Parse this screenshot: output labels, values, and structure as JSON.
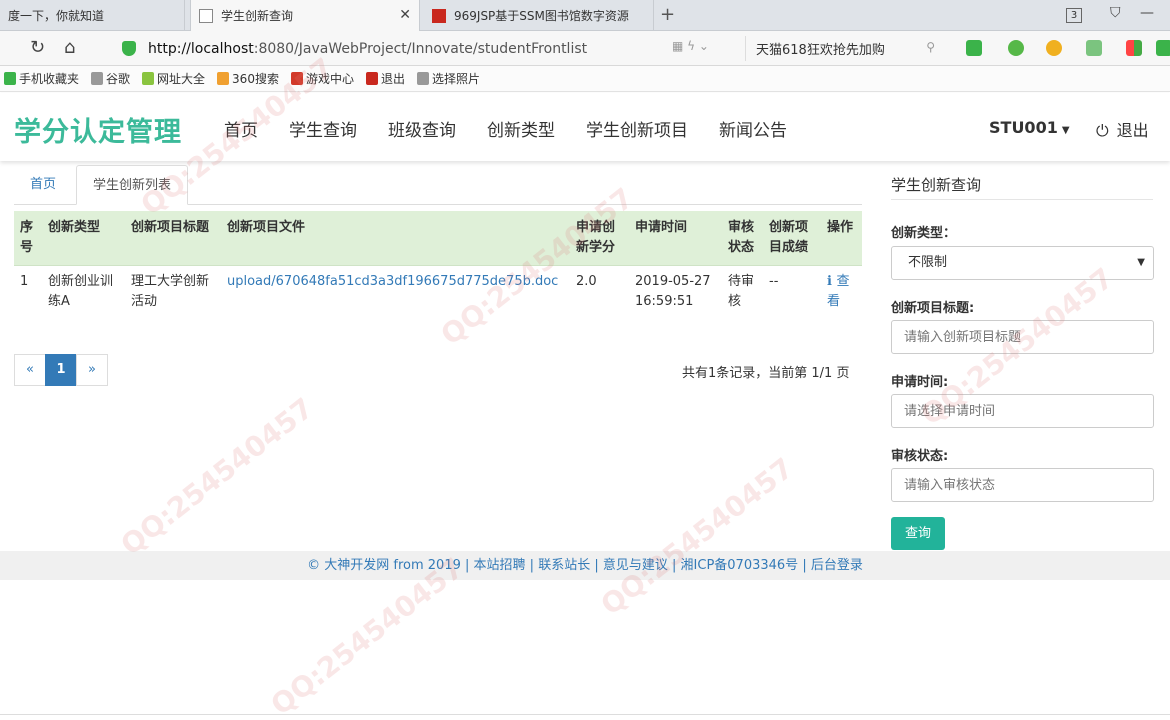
{
  "browser": {
    "tabs": [
      {
        "title": "度一下，你就知道"
      },
      {
        "title": "学生创新查询"
      },
      {
        "title": "969JSP基于SSM图书馆数字资源"
      }
    ],
    "window_count": "3",
    "url_host": "http://localhost",
    "url_rest": ":8080/JavaWebProject/Innovate/studentFrontlist",
    "search_text": "天猫618狂欢抢先加购"
  },
  "bookmarks": [
    {
      "label": "手机收藏夹",
      "color": "#3bb34a"
    },
    {
      "label": "谷歌",
      "color": "#999999"
    },
    {
      "label": "网址大全",
      "color": "#8ac43f"
    },
    {
      "label": "360搜索",
      "color": "#f0a030"
    },
    {
      "label": "游戏中心",
      "color": "#d23a2a"
    },
    {
      "label": "退出",
      "color": "#c9281e"
    },
    {
      "label": "选择照片",
      "color": "#999999"
    }
  ],
  "nav": {
    "brand": "学分认定管理",
    "links": [
      "首页",
      "学生查询",
      "班级查询",
      "创新类型",
      "学生创新项目",
      "新闻公告"
    ],
    "user": "STU001",
    "logout": "退出"
  },
  "page_tabs": {
    "home": "首页",
    "active": "学生创新列表"
  },
  "table": {
    "headers": [
      "序号",
      "创新类型",
      "创新项目标题",
      "创新项目文件",
      "申请创新学分",
      "申请时间",
      "审核状态",
      "创新项目成绩",
      "操作"
    ],
    "rows": [
      {
        "no": "1",
        "type": "创新创业训练A",
        "title": "理工大学创新活动",
        "file": "upload/670648fa51cd3a3df196675d775de75b.doc",
        "credit": "2.0",
        "time": "2019-05-27 16:59:51",
        "status": "待审核",
        "score": "--",
        "action": "查看"
      }
    ]
  },
  "pager": {
    "prev": "«",
    "current": "1",
    "next": "»",
    "info": "共有1条记录，当前第 1/1 页"
  },
  "sidebar": {
    "title": "学生创新查询",
    "type_label": "创新类型：",
    "type_value": "不限制",
    "title_label": "创新项目标题:",
    "title_placeholder": "请输入创新项目标题",
    "time_label": "申请时间:",
    "time_placeholder": "请选择申请时间",
    "status_label": "审核状态:",
    "status_placeholder": "请输入审核状态",
    "query_button": "查询"
  },
  "footer": {
    "copyright": "© 大神开发网 from 2019",
    "links": [
      "本站招聘",
      "联系站长",
      "意见与建议",
      "湘ICP备0703346号",
      "后台登录"
    ]
  },
  "watermark": "QQ:254540457",
  "colors": {
    "brand": "#3cba9a",
    "link": "#337ab7",
    "table_header": "#dff0d8",
    "query_button": "#22b39a"
  }
}
